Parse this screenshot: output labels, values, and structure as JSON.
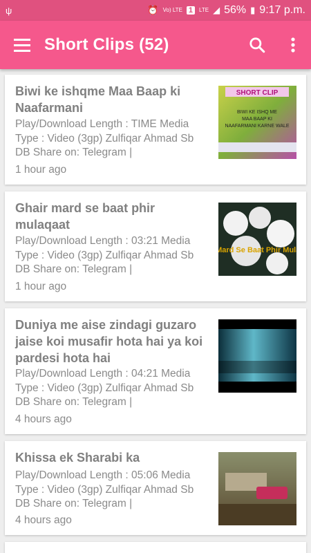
{
  "status_bar": {
    "battery": "56%",
    "time": "9:17 p.m.",
    "network": "LTE",
    "volte": "Vo) LTE",
    "sim": "1"
  },
  "app_bar": {
    "title": "Short Clips (52)",
    "icons": [
      "menu-icon",
      "search-icon",
      "more-vert-icon"
    ]
  },
  "clips": [
    {
      "title": "Biwi ke ishqme Maa Baap ki Naafarmani",
      "desc": "Play/Download Length : TIME Media Type :  Video (3gp) Zulfiqar Ahmad Sb DB Share on: Telegram |",
      "time": "1 hour ago",
      "thumb_caption": "SHORT CLIP"
    },
    {
      "title": "Ghair mard se baat phir mulaqaat",
      "desc": "Play/Download Length : 03:21 Media Type :  Video (3gp) Zulfiqar Ahmad Sb DB Share on: Telegram |",
      "time": "1 hour ago",
      "thumb_caption": "Gair Mard Se Baat Phir Mulaqaat"
    },
    {
      "title": "Duniya me aise zindagi guzaro jaise koi musafir hota hai ya koi pardesi hota hai",
      "desc": "Play/Download Length : 04:21 Media Type :  Video (3gp) Zulfiqar Ahmad Sb DB Share on: Telegram |",
      "time": "4 hours ago",
      "thumb_caption": ""
    },
    {
      "title": "Khissa ek Sharabi ka",
      "desc": "Play/Download Length : 05:06 Media Type :  Video (3gp) Zulfiqar Ahmad Sb DB Share on: Telegram |",
      "time": "4 hours ago",
      "thumb_caption": ""
    }
  ]
}
